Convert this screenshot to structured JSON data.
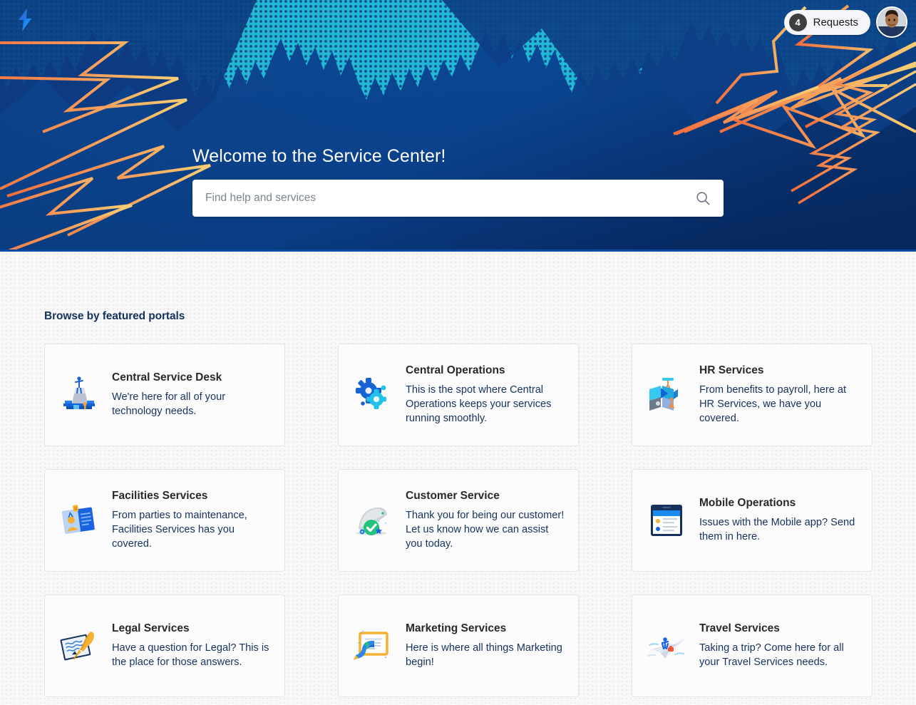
{
  "hero": {
    "logo_icon": "lightning-bolt-logo",
    "title": "Welcome to the Service Center!",
    "search": {
      "placeholder": "Find help and services",
      "value": "",
      "icon": "search-icon"
    },
    "colors": {
      "bg_dark": "#0a2f6e",
      "bg_mid": "#0b4ea2",
      "halftone_cyan": "#21b8d8",
      "bolt_orange": "#f58a4b",
      "bolt_yellow": "#f6c463"
    }
  },
  "utility": {
    "requests": {
      "count": "4",
      "label": "Requests"
    },
    "avatar": {
      "icon": "user-avatar-photo"
    }
  },
  "main": {
    "heading": "Browse by featured portals",
    "cards": [
      {
        "icon": "service-desk-podium-icon",
        "title": "Central Service Desk",
        "description": "We're here for all of your technology needs."
      },
      {
        "icon": "gears-icon",
        "title": "Central Operations",
        "description": "This is the spot where Central Operations keeps your services running smoothly."
      },
      {
        "icon": "hr-people-panels-icon",
        "title": "HR Services",
        "description": "From benefits to payroll, here at HR Services, we have you covered."
      },
      {
        "icon": "facilities-badge-icon",
        "title": "Facilities Services",
        "description": "From parties to maintenance, Facilities Services has you covered."
      },
      {
        "icon": "service-dome-check-icon",
        "title": "Customer Service",
        "description": "Thank you for being our customer! Let us know how we can assist you today."
      },
      {
        "icon": "mobile-device-icon",
        "title": "Mobile Operations",
        "description": "Issues with the Mobile app? Send them in here."
      },
      {
        "icon": "legal-quill-document-icon",
        "title": "Legal Services",
        "description": "Have a question for Legal? This is the place for those answers."
      },
      {
        "icon": "marketing-easel-icon",
        "title": "Marketing Services",
        "description": "Here is where all things Marketing begin!"
      },
      {
        "icon": "travel-paper-plane-icon",
        "title": "Travel Services",
        "description": "Taking a trip? Come here for all your Travel Services needs."
      }
    ]
  }
}
